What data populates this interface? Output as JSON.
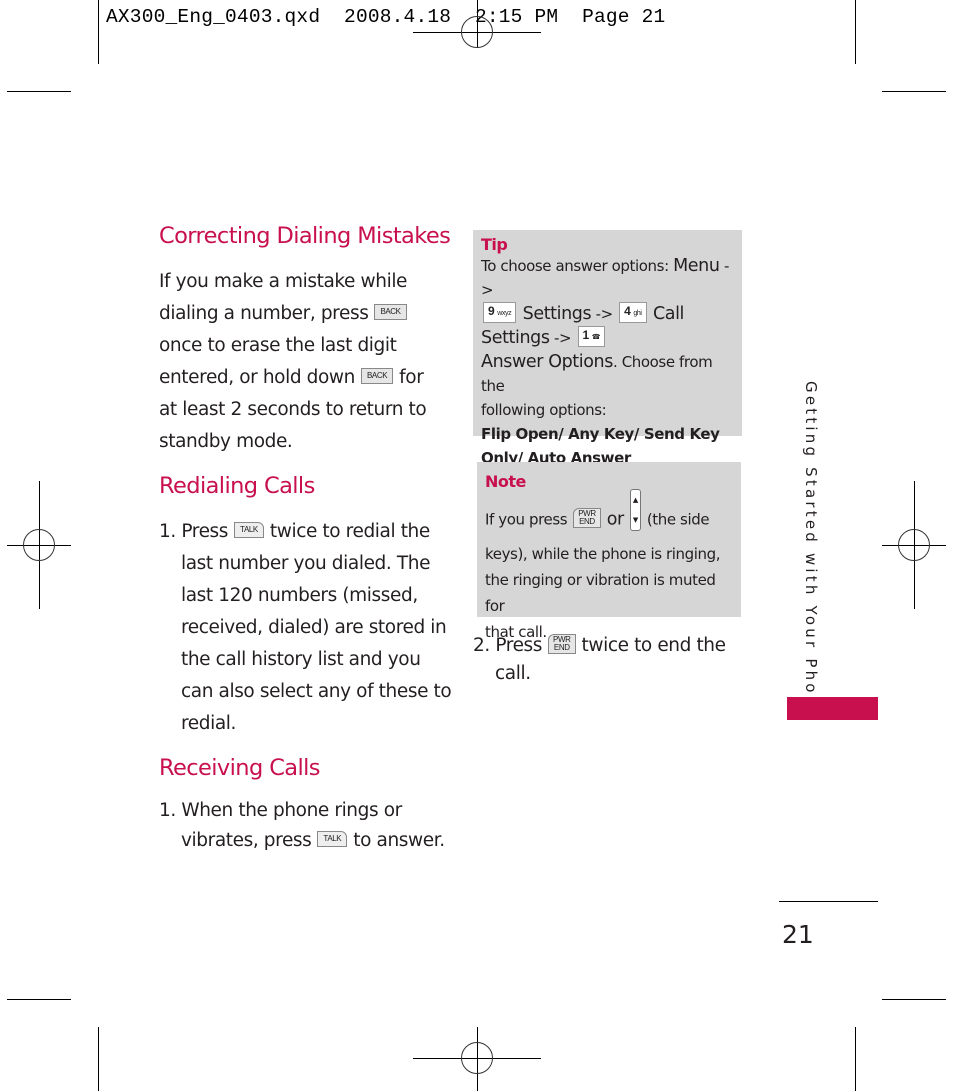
{
  "slug": "AX300_Eng_0403.qxd  2008.4.18  2:15 PM  Page 21",
  "left": {
    "correcting": {
      "heading": "Correcting Dialing Mistakes",
      "l1": "If you make a mistake while",
      "l2": "dialing a number, press",
      "l3": "once to erase the last digit",
      "l4a": "entered, or hold down",
      "l4b": "for",
      "l5": "at least 2 seconds to return to",
      "l6": "standby mode.",
      "key": "BACK"
    },
    "redialing": {
      "heading": "Redialing Calls",
      "num": "1.",
      "l1a": "Press",
      "l1b": "twice to redial the",
      "l2": "last number you dialed. The",
      "l3": "last 120 numbers (missed,",
      "l4": "received, dialed) are stored in",
      "l5": "the call history list and you",
      "l6": "can also select any of these to",
      "l7": "redial.",
      "key": "TALK"
    },
    "receiving": {
      "heading": "Receiving Calls",
      "num": "1.",
      "l1": "When the phone rings or",
      "l2a": "vibrates, press",
      "l2b": "to answer.",
      "key": "TALK"
    }
  },
  "tip": {
    "title": "Tip",
    "intro": "To choose answer options:",
    "menu": "Menu",
    "arrow": "->",
    "key9": "9",
    "key9sub": "wxyz",
    "settings": "Settings",
    "key4": "4",
    "key4sub": "ghi",
    "call": "Call",
    "settings2": "Settings",
    "key1": "1",
    "key1sub": "☎",
    "answer_options": "Answer Options",
    "choose": ". Choose from the",
    "following": "following options:",
    "options1": "Flip Open/ Any Key/ Send Key",
    "options2": "Only/ Auto Answer"
  },
  "note": {
    "title": "Note",
    "l1a": "If you press",
    "or": "or",
    "l1b": "(the side",
    "l2": "keys), while the phone is ringing,",
    "l3": "the ringing or vibration is muted for",
    "l4": "that call.",
    "end_top": "PWR",
    "end_bottom": "END",
    "side_up": "▲",
    "side_down": "▼"
  },
  "step2": {
    "num": "2.",
    "l1a": "Press",
    "l1b": "twice to end the",
    "l2": "call.",
    "end_top": "PWR",
    "end_bottom": "END"
  },
  "side_tab": "Getting Started with Your Phone",
  "page_number": "21",
  "accent_color": "#c8104e",
  "box_color": "#d6d6d6"
}
